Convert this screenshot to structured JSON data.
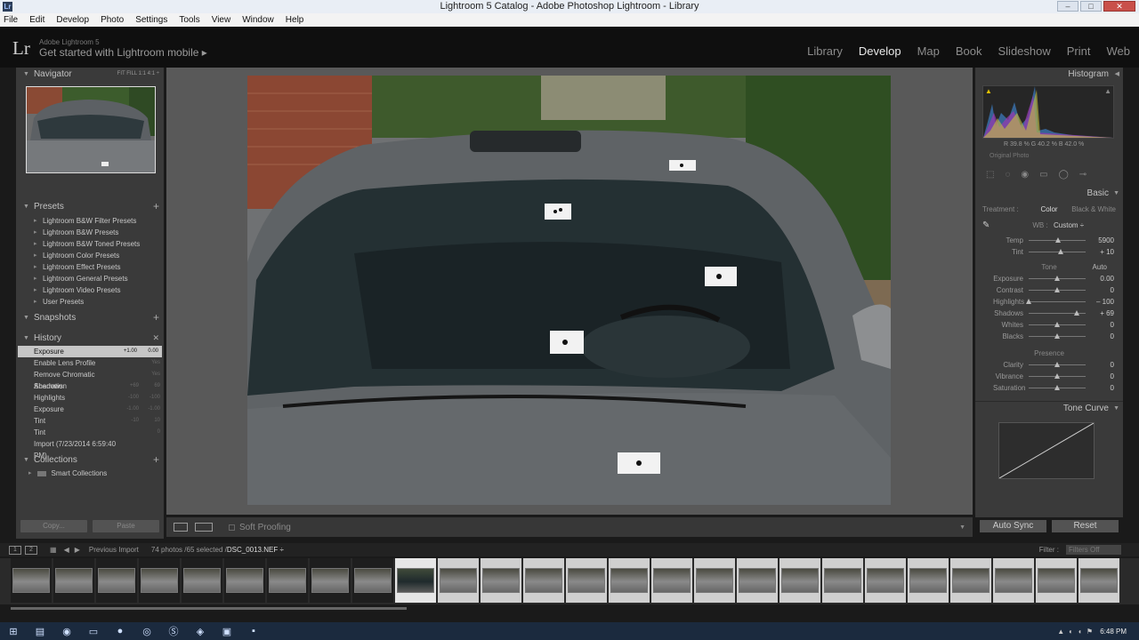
{
  "window": {
    "title": "Lightroom 5 Catalog - Adobe Photoshop Lightroom - Library",
    "app_icon": "Lr",
    "minimize": "–",
    "maximize": "□",
    "close": "✕"
  },
  "menu": [
    "File",
    "Edit",
    "Develop",
    "Photo",
    "Settings",
    "Tools",
    "View",
    "Window",
    "Help"
  ],
  "identity": {
    "logo": "Lr",
    "subtitle": "Adobe Lightroom 5",
    "mobile_text": "Get started with Lightroom mobile  ▸"
  },
  "modules": [
    "Library",
    "Develop",
    "Map",
    "Book",
    "Slideshow",
    "Print",
    "Web"
  ],
  "active_module": "Develop",
  "left": {
    "navigator": {
      "label": "Navigator",
      "options": "FIT  FILL  1:1  4:1 ÷"
    },
    "presets": {
      "label": "Presets",
      "items": [
        "Lightroom B&W Filter Presets",
        "Lightroom B&W Presets",
        "Lightroom B&W Toned Presets",
        "Lightroom Color Presets",
        "Lightroom Effect Presets",
        "Lightroom General Presets",
        "Lightroom Video Presets",
        "User Presets"
      ]
    },
    "snapshots": {
      "label": "Snapshots"
    },
    "history": {
      "label": "History",
      "items": [
        {
          "name": "Exposure",
          "a": "+1.00",
          "b": "0.00"
        },
        {
          "name": "Enable Lens Profile",
          "a": "",
          "b": "Yes"
        },
        {
          "name": "Remove Chromatic Aberration",
          "a": "",
          "b": "Yes"
        },
        {
          "name": "Shadows",
          "a": "+69",
          "b": "69"
        },
        {
          "name": "Highlights",
          "a": "-100",
          "b": "-100"
        },
        {
          "name": "Exposure",
          "a": "-1.00",
          "b": "-1.00"
        },
        {
          "name": "Tint",
          "a": "-10",
          "b": "10"
        },
        {
          "name": "Tint",
          "a": "",
          "b": "0"
        },
        {
          "name": "Import (7/23/2014 6:59:40 PM)",
          "a": "",
          "b": ""
        }
      ]
    },
    "collections": {
      "label": "Collections",
      "items": [
        "Smart Collections"
      ]
    },
    "copy_button": "Copy...",
    "paste_button": "Paste"
  },
  "toolbar": {
    "soft_proofing": "Soft Proofing"
  },
  "right": {
    "histogram": {
      "label": "Histogram",
      "readout": "R  39.8  %   G  40.2  %   B  42.0  %",
      "original_photo": "Original Photo"
    },
    "basic": {
      "label": "Basic",
      "treatment_label": "Treatment :",
      "treatment_color": "Color",
      "treatment_bw": "Black & White",
      "wb_label": "WB :",
      "wb_value": "Custom ÷",
      "tone_label": "Tone",
      "auto_label": "Auto",
      "presence_label": "Presence",
      "sliders_wb": [
        {
          "label": "Temp",
          "value": "5900",
          "level": 0.52
        },
        {
          "label": "Tint",
          "value": "+ 10",
          "level": 0.56
        }
      ],
      "sliders_tone": [
        {
          "label": "Exposure",
          "value": "0.00",
          "level": 0.5
        },
        {
          "label": "Contrast",
          "value": "0",
          "level": 0.5
        },
        {
          "label": "Highlights",
          "value": "– 100",
          "level": 0.0
        },
        {
          "label": "Shadows",
          "value": "+ 69",
          "level": 0.85
        },
        {
          "label": "Whites",
          "value": "0",
          "level": 0.5
        },
        {
          "label": "Blacks",
          "value": "0",
          "level": 0.5
        }
      ],
      "sliders_presence": [
        {
          "label": "Clarity",
          "value": "0",
          "level": 0.5
        },
        {
          "label": "Vibrance",
          "value": "0",
          "level": 0.5
        },
        {
          "label": "Saturation",
          "value": "0",
          "level": 0.5
        }
      ]
    },
    "tone_curve": {
      "label": "Tone Curve"
    },
    "auto_sync_button": "Auto Sync",
    "reset_button": "Reset"
  },
  "filmstrip": {
    "source": "Previous Import",
    "info": "74 photos /65 selected /",
    "filename": "DSC_0013.NEF ÷",
    "filter_label": "Filter :",
    "filter_value": "Filters Off",
    "thumb_count": 26,
    "active_index": 9
  },
  "taskbar": {
    "clock": "6:48 PM"
  }
}
